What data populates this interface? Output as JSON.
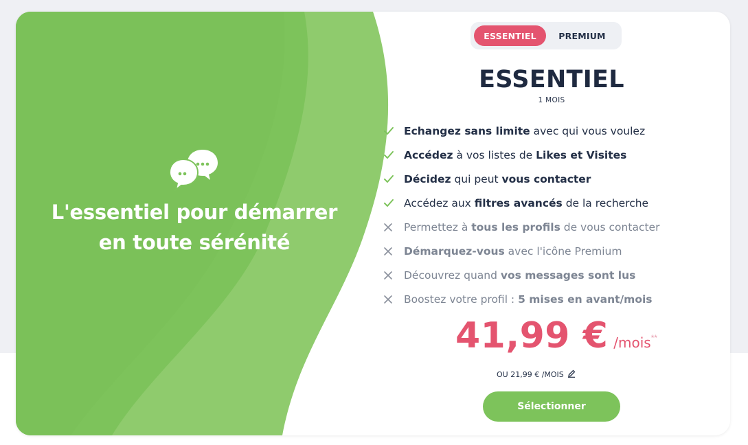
{
  "colors": {
    "accent": "#e4546f",
    "green_dark": "#7dc35b",
    "green_light": "#8fcb6d",
    "text_dark": "#243047",
    "text_muted": "#7d8593"
  },
  "left_panel": {
    "icon": "chat-bubbles-icon",
    "tagline": "L'essentiel pour démarrer en toute sérénité"
  },
  "plan_toggle": {
    "options": [
      {
        "label": "ESSENTIEL",
        "active": true
      },
      {
        "label": "PREMIUM",
        "active": false
      }
    ]
  },
  "plan": {
    "title": "ESSENTIEL",
    "duration": "1 MOIS",
    "features": [
      {
        "included": true,
        "icon": "check-icon",
        "segments": [
          {
            "text": "Echangez sans limite",
            "bold": true
          },
          {
            "text": " avec qui vous voulez",
            "bold": false
          }
        ]
      },
      {
        "included": true,
        "icon": "check-icon",
        "segments": [
          {
            "text": "Accédez",
            "bold": true
          },
          {
            "text": " à vos listes de ",
            "bold": false
          },
          {
            "text": "Likes et Visites",
            "bold": true
          }
        ]
      },
      {
        "included": true,
        "icon": "check-icon",
        "segments": [
          {
            "text": "Décidez",
            "bold": true
          },
          {
            "text": " qui peut ",
            "bold": false
          },
          {
            "text": "vous contacter",
            "bold": true
          }
        ]
      },
      {
        "included": true,
        "icon": "check-icon",
        "segments": [
          {
            "text": "Accédez aux ",
            "bold": false
          },
          {
            "text": "filtres avancés",
            "bold": true
          },
          {
            "text": " de la recherche",
            "bold": false
          }
        ]
      },
      {
        "included": false,
        "icon": "cross-icon",
        "segments": [
          {
            "text": "Permettez à ",
            "bold": false
          },
          {
            "text": "tous les profils",
            "bold": true
          },
          {
            "text": " de vous contacter",
            "bold": false
          }
        ]
      },
      {
        "included": false,
        "icon": "cross-icon",
        "segments": [
          {
            "text": "Démarquez-vous",
            "bold": true
          },
          {
            "text": " avec l'icône Premium",
            "bold": false
          }
        ]
      },
      {
        "included": false,
        "icon": "cross-icon",
        "segments": [
          {
            "text": "Découvrez quand ",
            "bold": false
          },
          {
            "text": "vos messages sont lus",
            "bold": true
          }
        ]
      },
      {
        "included": false,
        "icon": "cross-icon",
        "segments": [
          {
            "text": "Boostez votre profil : ",
            "bold": false
          },
          {
            "text": "5 mises en avant/mois",
            "bold": true
          }
        ]
      }
    ],
    "price": {
      "amount": "41,99 €",
      "unit": "/mois",
      "footnote_mark": "**"
    },
    "alt_price": "OU 21,99 € /MOIS",
    "alt_price_icon": "pencil-icon",
    "select_label": "Sélectionner"
  }
}
